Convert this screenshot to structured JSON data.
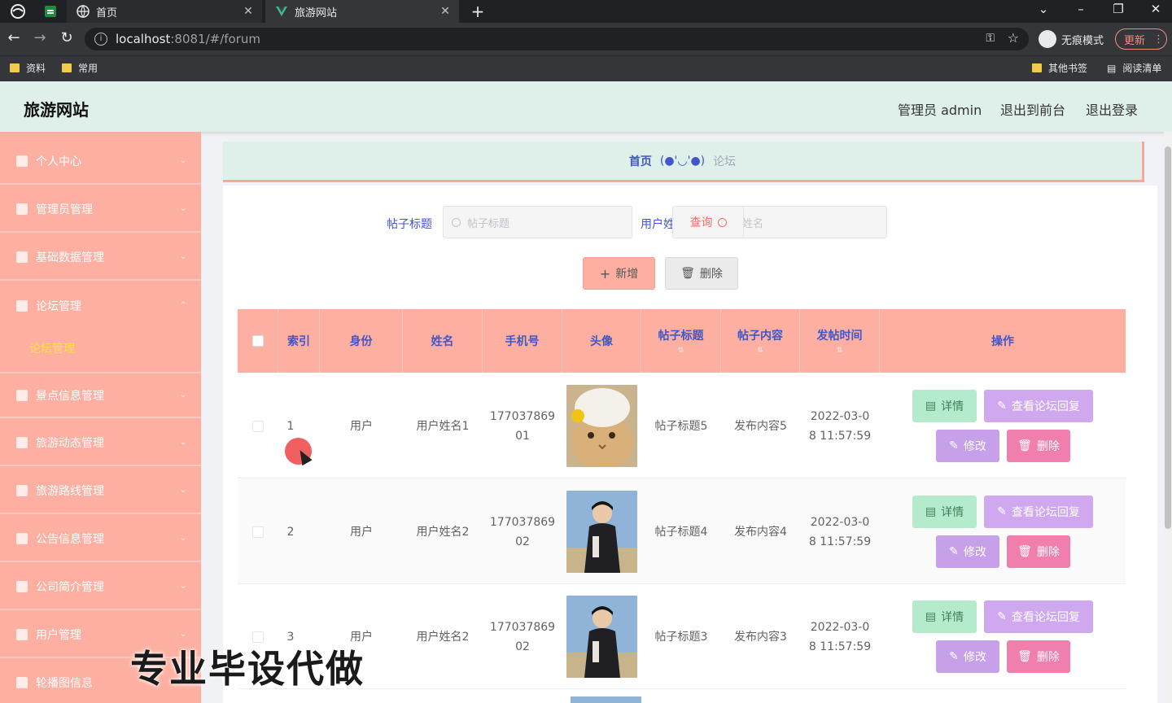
{
  "browser": {
    "tabs": [
      {
        "title": "首页"
      },
      {
        "title": "旅游网站"
      }
    ],
    "url_host": "localhost",
    "url_path": ":8081/#/forum",
    "incognito_label": "无痕模式",
    "update_label": "更新",
    "bookmarks": [
      "资料",
      "常用"
    ],
    "bookmarks_right": [
      "其他书签",
      "阅读清单"
    ]
  },
  "header": {
    "site_title": "旅游网站",
    "admin_label": "管理员 admin",
    "to_front": "退出到前台",
    "logout": "退出登录"
  },
  "sidebar": {
    "items": [
      {
        "label": "个人中心",
        "icon": "user-icon"
      },
      {
        "label": "管理员管理",
        "icon": "send-icon"
      },
      {
        "label": "基础数据管理",
        "icon": "flag-icon"
      },
      {
        "label": "论坛管理",
        "icon": "copy-icon"
      },
      {
        "label": "景点信息管理",
        "icon": "crop-icon"
      },
      {
        "label": "旅游动态管理",
        "icon": "trophy-icon"
      },
      {
        "label": "旅游路线管理",
        "icon": "chat-icon"
      },
      {
        "label": "公告信息管理",
        "icon": "thumb-icon"
      },
      {
        "label": "公司简介管理",
        "icon": "list-icon"
      },
      {
        "label": "用户管理",
        "icon": "box-icon"
      },
      {
        "label": "轮播图信息",
        "icon": "film-icon"
      }
    ],
    "sub_item": "论坛管理"
  },
  "breadcrumb": {
    "home": "首页",
    "face": "(●'◡'●)",
    "current": "论坛"
  },
  "search": {
    "title_label": "帖子标题",
    "title_placeholder": "帖子标题",
    "user_label": "用户姓名",
    "user_placeholder": "用户姓名",
    "query_button": "查询"
  },
  "actions": {
    "add": "新增",
    "delete": "删除"
  },
  "table": {
    "columns": [
      "索引",
      "身份",
      "姓名",
      "手机号",
      "头像",
      "帖子标题",
      "帖子内容",
      "发帖时间",
      "操作"
    ],
    "rows": [
      {
        "index": "1",
        "role": "用户",
        "name": "用户姓名1",
        "phone": "17703786901",
        "title": "帖子标题5",
        "content": "发布内容5",
        "time": "2022-03-08 11:57:59",
        "avatar": "cat"
      },
      {
        "index": "2",
        "role": "用户",
        "name": "用户姓名2",
        "phone": "17703786902",
        "title": "帖子标题4",
        "content": "发布内容4",
        "time": "2022-03-08 11:57:59",
        "avatar": "person"
      },
      {
        "index": "3",
        "role": "用户",
        "name": "用户姓名2",
        "phone": "17703786902",
        "title": "帖子标题3",
        "content": "发布内容3",
        "time": "2022-03-08 11:57:59",
        "avatar": "person"
      }
    ],
    "op_labels": {
      "detail": "详情",
      "reply": "查看论坛回复",
      "edit": "修改",
      "delete": "删除"
    }
  },
  "watermark": "专业毕设代做"
}
